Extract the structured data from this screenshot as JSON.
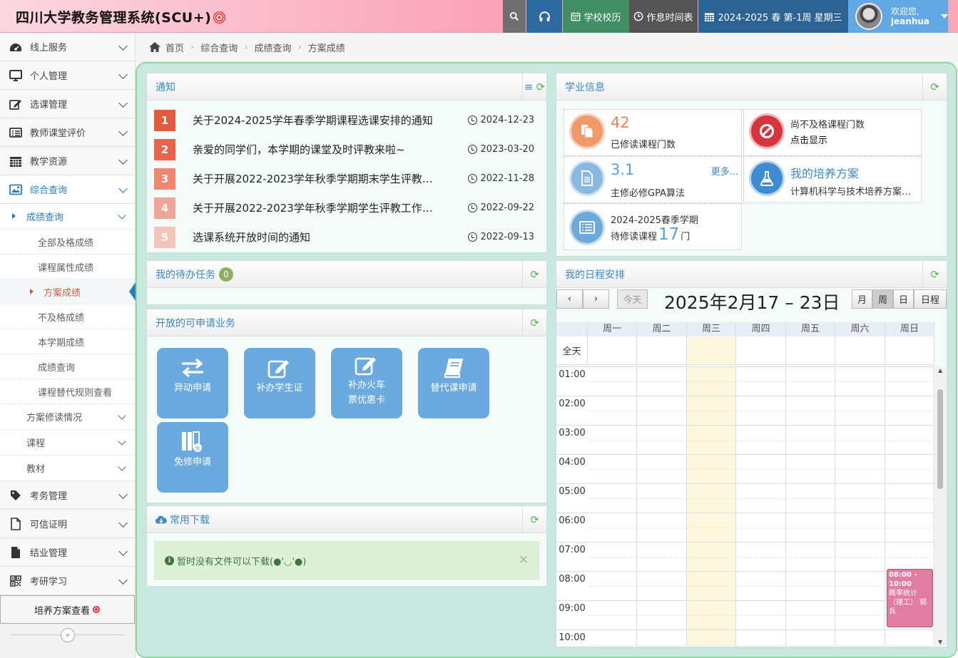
{
  "header": {
    "title": "四川大学教务管理系统(SCU+)",
    "calendar_btn": "学校校历",
    "schedule_btn": "作息时间表",
    "week_info": "2024-2025 春 第-1周 星期三",
    "welcome": "欢迎您,",
    "username": "jeanhua"
  },
  "sidebar": {
    "items": [
      {
        "label": "线上服务",
        "icon": "dashboard-icon"
      },
      {
        "label": "个人管理",
        "icon": "desktop-icon"
      },
      {
        "label": "选课管理",
        "icon": "edit-icon"
      },
      {
        "label": "教师课堂评价",
        "icon": "list-icon"
      },
      {
        "label": "教学资源",
        "icon": "calendar-icon"
      },
      {
        "label": "综合查询",
        "icon": "picture-icon"
      }
    ],
    "sub_open": "成绩查询",
    "sub_items": [
      "全部及格成绩",
      "课程属性成绩",
      "方案成绩",
      "不及格成绩",
      "本学期成绩",
      "成绩查询",
      "课程替代规则查看"
    ],
    "sub_after": [
      "方案修读情况",
      "课程",
      "教材"
    ],
    "items_bottom": [
      {
        "label": "考务管理",
        "icon": "tag-icon"
      },
      {
        "label": "可信证明",
        "icon": "file-icon"
      },
      {
        "label": "结业管理",
        "icon": "file-solid-icon"
      },
      {
        "label": "考研学习",
        "icon": "qrcode-icon"
      }
    ],
    "footer_button": "培养方案查看"
  },
  "breadcrumb": [
    "首页",
    "综合查询",
    "成绩查询",
    "方案成绩"
  ],
  "notice": {
    "title": "通知",
    "items": [
      {
        "num": "1",
        "title": "关于2024-2025学年春季学期课程选课安排的通知",
        "date": "2024-12-23",
        "color": "#e35b3f"
      },
      {
        "num": "2",
        "title": "亲爱的同学们，本学期的课堂及时评教来啦~",
        "date": "2023-03-20",
        "color": "#e8644a"
      },
      {
        "num": "3",
        "title": "关于开展2022-2023学年秋季学期期末学生评教…",
        "date": "2022-11-28",
        "color": "#ee8670"
      },
      {
        "num": "4",
        "title": "关于开展2022-2023学年秋季学期学生评教工作…",
        "date": "2022-09-22",
        "color": "#f1a597"
      },
      {
        "num": "5",
        "title": "选课系统开放时间的通知",
        "date": "2022-09-13",
        "color": "#f4c3ba"
      }
    ]
  },
  "todo": {
    "title": "我的待办任务",
    "count": "0"
  },
  "services": {
    "title": "开放的可申请业务",
    "items": [
      "异动申请",
      "补办学生证",
      "补办火车票优惠卡",
      "替代课申请",
      "免修申请"
    ],
    "train_line1": "补办火车",
    "train_line2": "票优惠卡"
  },
  "downloads": {
    "title": "常用下载",
    "empty_msg": "暂时没有文件可以下载(●'◡'●)"
  },
  "academic": {
    "title": "学业信息",
    "courses_taken": "42",
    "courses_taken_label": "已修读课程门数",
    "failed_label": "尚不及格课程门数",
    "failed_action": "点击显示",
    "gpa": "3.1",
    "gpa_label": "主修必修GPA算法",
    "more": "更多...",
    "plan_title": "我的培养方案",
    "plan_desc": "计算机科学与技术培养方案…",
    "semester": "2024-2025春季学期",
    "pending_prefix": "待修读课程",
    "pending_count": "17",
    "pending_suffix": "门"
  },
  "schedule": {
    "title": "我的日程安排",
    "today": "今天",
    "range": "2025年2月17 – 23日",
    "views": [
      "月",
      "周",
      "日",
      "日程"
    ],
    "days": [
      "周一",
      "周二",
      "周三",
      "周四",
      "周五",
      "周六",
      "周日"
    ],
    "allday": "全天",
    "hours": [
      "01:00",
      "02:00",
      "03:00",
      "04:00",
      "05:00",
      "06:00",
      "07:00",
      "08:00",
      "09:00",
      "10:00"
    ],
    "event": {
      "time": "08:00 - 10:00",
      "title": "概率统计（理工） 郭兵"
    }
  },
  "colors": {
    "accent": "#2b7dbc",
    "service": "#6aaadf",
    "refresh": "#5bb45b"
  }
}
